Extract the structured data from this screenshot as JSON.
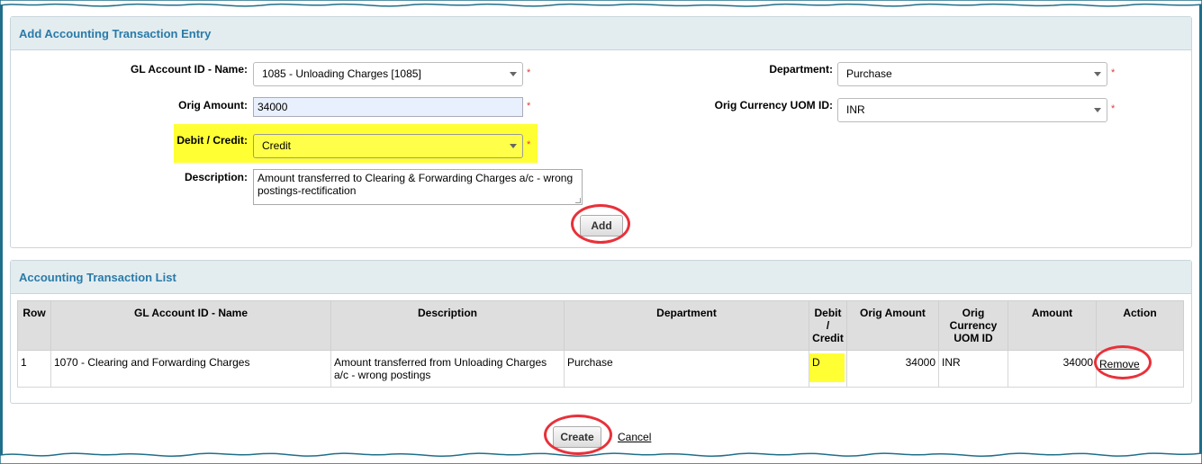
{
  "entry_panel": {
    "title": "Add Accounting Transaction Entry",
    "gl_account": {
      "label": "GL Account ID - Name:",
      "value": "1085 - Unloading Charges [1085]"
    },
    "department": {
      "label": "Department:",
      "value": "Purchase"
    },
    "orig_amount": {
      "label": "Orig Amount:",
      "value": "34000"
    },
    "orig_currency": {
      "label": "Orig Currency UOM ID:",
      "value": "INR"
    },
    "debit_credit": {
      "label": "Debit / Credit:",
      "value": "Credit"
    },
    "description": {
      "label": "Description:",
      "value": "Amount transferred to Clearing & Forwarding Charges a/c - wrong postings-rectification"
    },
    "required_mark": "*",
    "add_button": "Add"
  },
  "list_panel": {
    "title": "Accounting Transaction List",
    "columns": [
      "Row",
      "GL Account ID - Name",
      "Description",
      "Department",
      "Debit / Credit",
      "Orig Amount",
      "Orig Currency UOM ID",
      "Amount",
      "Action"
    ],
    "rows": [
      {
        "row": "1",
        "gl_account": "1070 - Clearing and Forwarding Charges",
        "description": "Amount transferred from Unloading Charges a/c - wrong postings",
        "department": "Purchase",
        "debit_credit": "D",
        "orig_amount": "34000",
        "currency": "INR",
        "amount": "34000",
        "action": "Remove"
      }
    ]
  },
  "footer": {
    "create_button": "Create",
    "cancel_link": "Cancel"
  },
  "colors": {
    "accent": "#2a7aa8",
    "highlight": "#ffff33",
    "annotation": "#e8313a",
    "border": "#1f6f8b"
  }
}
